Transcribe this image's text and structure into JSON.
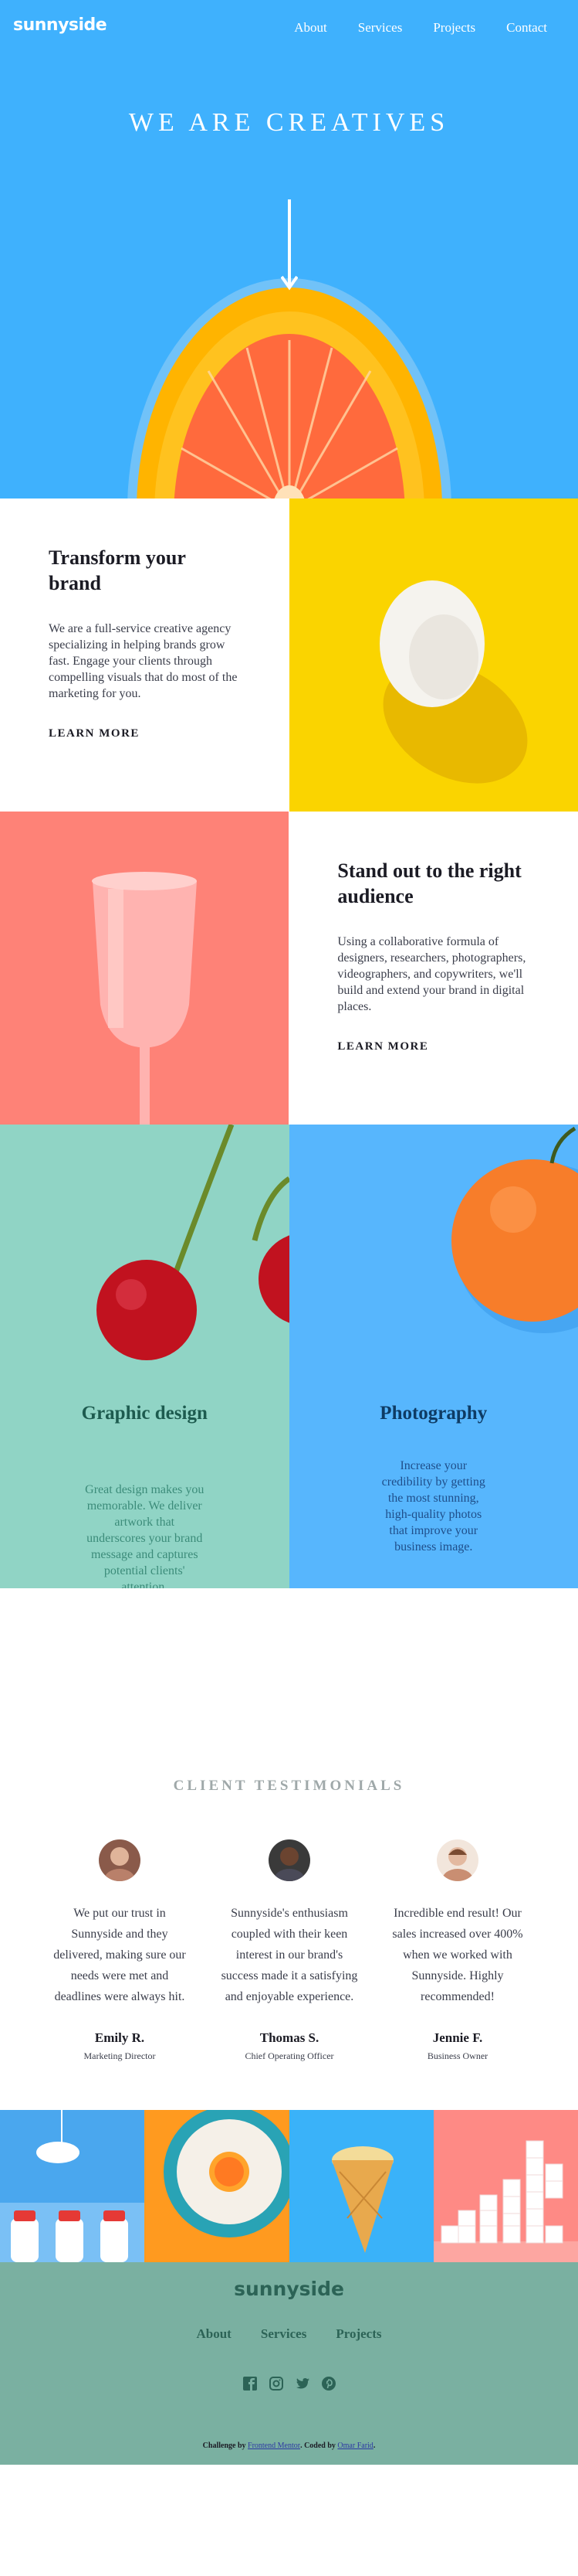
{
  "header": {
    "logo": "sunnyside",
    "nav": [
      "About",
      "Services",
      "Projects",
      "Contact"
    ]
  },
  "hero": {
    "title": "WE ARE CREATIVES"
  },
  "feature1": {
    "title": "Transform your brand",
    "body": "We are a full-service creative agency specializing in helping brands grow fast. Engage your clients through compelling visuals that do most of the marketing for you.",
    "link": "LEARN MORE"
  },
  "feature2": {
    "title": "Stand out to the right audience",
    "body": "Using a collaborative formula of designers, researchers, photographers, videographers, and copywriters, we'll build and extend your brand in digital places.",
    "link": "LEARN MORE"
  },
  "services": [
    {
      "title": "Graphic design",
      "body": "Great design makes you memorable. We deliver artwork that underscores your brand message and captures potential clients' attention."
    },
    {
      "title": "Photography",
      "body": "Increase your credibility by getting the most stunning, high-quality photos that improve your business image."
    }
  ],
  "testimonials": {
    "heading": "CLIENT TESTIMONIALS",
    "items": [
      {
        "quote": "We put our trust in Sunnyside and they delivered, making sure our needs were met and deadlines were always hit.",
        "name": "Emily R.",
        "role": "Marketing Director"
      },
      {
        "quote": "Sunnyside's enthusiasm coupled with their keen interest in our brand's success made it a satisfying and enjoyable experience.",
        "name": "Thomas S.",
        "role": "Chief Operating Officer"
      },
      {
        "quote": "Incredible end result! Our sales increased over 400% when we worked with Sunnyside. Highly recommended!",
        "name": "Jennie F.",
        "role": "Business Owner"
      }
    ]
  },
  "footer": {
    "logo": "sunnyside",
    "nav": [
      "About",
      "Services",
      "Projects"
    ],
    "social": [
      "facebook-icon",
      "instagram-icon",
      "twitter-icon",
      "pinterest-icon"
    ],
    "attribution": {
      "prefix": "Challenge by",
      "mentor": "Frontend Mentor",
      "mid": ". Coded by",
      "author": "Omar Farid",
      "suffix": "."
    }
  },
  "colors": {
    "hero_blue": "#3fb1fd",
    "yellow": "#fad400",
    "coral": "#fe8277",
    "mint": "#90d4c5",
    "photo_blue": "#57b6fd",
    "footer_green": "#7ab0a1"
  }
}
